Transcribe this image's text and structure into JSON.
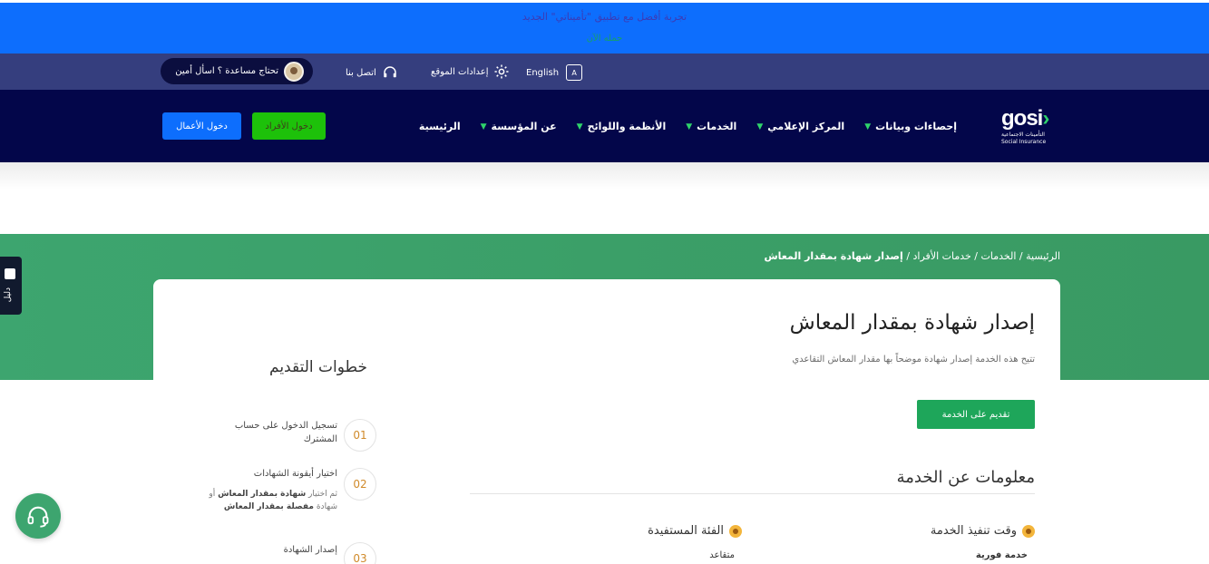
{
  "banner": {
    "line1": "تجربة أفضل مع تطبيق \"تأميناتي\" الجديد",
    "line2": "حمله الآن"
  },
  "topbar": {
    "language": "English",
    "settings": "إعدادات الموقع",
    "contact": "اتصل بنا",
    "help": "تحتاج مساعدة ؟ اسأل أمين"
  },
  "logo": {
    "word": "gosi",
    "arabic": "التأمينات الاجتماعية",
    "english": "Social Insurance"
  },
  "nav": {
    "items": [
      "الرئيسية",
      "عن المؤسسة",
      "الأنظمة واللوائح",
      "الخدمات",
      "المركز الإعلامي",
      "إحصاءات وبيانات"
    ],
    "login_individuals": "دخول الأفراد",
    "login_business": "دخول الأعمال"
  },
  "breadcrumb": {
    "home": "الرئيسية",
    "services": "الخدمات",
    "individual_services": "خدمات الأفراد",
    "current": "إصدار شهادة بمقدار المعاش",
    "separator": " / "
  },
  "side_tab": {
    "label": "دليل"
  },
  "service": {
    "title": "إصدار شهادة بمقدار المعاش",
    "description": "تتيح هذه الخدمة إصدار شهادة موضحاً بها مقدار المعاش التقاعدي",
    "apply_label": "تقديم على الخدمة",
    "info_title": "معلومات عن الخدمة",
    "time_label": "وقت تنفيذ الخدمة",
    "time_value": "خدمة فورية",
    "target_label": "الفئة المستفيدة",
    "target_value": "متقاعد"
  },
  "steps": {
    "title": "خطوات التقديم",
    "items": [
      {
        "num": "01",
        "text": "تسجيل الدخول على حساب المشترك"
      },
      {
        "num": "02",
        "text": "اختيار أيقونة الشهادات",
        "sub_prefix": "ثم اختيار ",
        "sub_bold1": "شهادة بمقدار المعاش",
        "sub_mid": " أو شهادة ",
        "sub_bold2": "مفصلة بمقدار المعاش"
      },
      {
        "num": "03",
        "text": "إصدار الشهادة"
      }
    ]
  },
  "colors": {
    "banner": "#0d6efd",
    "topbar": "#353e7e",
    "navbar": "#03064a",
    "hero_green": "#3da56f",
    "apply_green": "#1ea65a",
    "accent_green": "#2fd36b"
  }
}
